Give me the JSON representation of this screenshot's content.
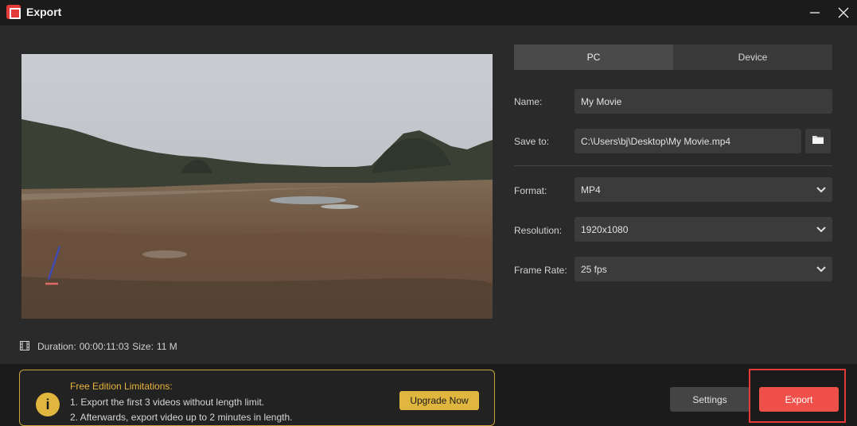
{
  "window": {
    "title": "Export",
    "minimize_icon": "minimize-icon",
    "close_icon": "close-icon"
  },
  "preview": {
    "duration_label": "Duration:",
    "duration_value": "00:00:11:03",
    "size_label": "Size:",
    "size_value": "11 M"
  },
  "tabs": [
    {
      "label": "PC",
      "active": true
    },
    {
      "label": "Device",
      "active": false
    }
  ],
  "form": {
    "name_label": "Name:",
    "name_value": "My Movie",
    "save_to_label": "Save to:",
    "save_to_value": "C:\\Users\\bj\\Desktop\\My Movie.mp4",
    "format_label": "Format:",
    "format_value": "MP4",
    "resolution_label": "Resolution:",
    "resolution_value": "1920x1080",
    "frame_rate_label": "Frame Rate:",
    "frame_rate_value": "25 fps"
  },
  "notice": {
    "title": "Free Edition Limitations:",
    "line1": "1. Export the first 3 videos without length limit.",
    "line2": "2. Afterwards, export video up to 2 minutes in length.",
    "upgrade_label": "Upgrade Now"
  },
  "actions": {
    "settings_label": "Settings",
    "export_label": "Export"
  },
  "colors": {
    "accent": "#f0504a",
    "warning": "#e0b63f",
    "background": "#2a2a2a"
  }
}
